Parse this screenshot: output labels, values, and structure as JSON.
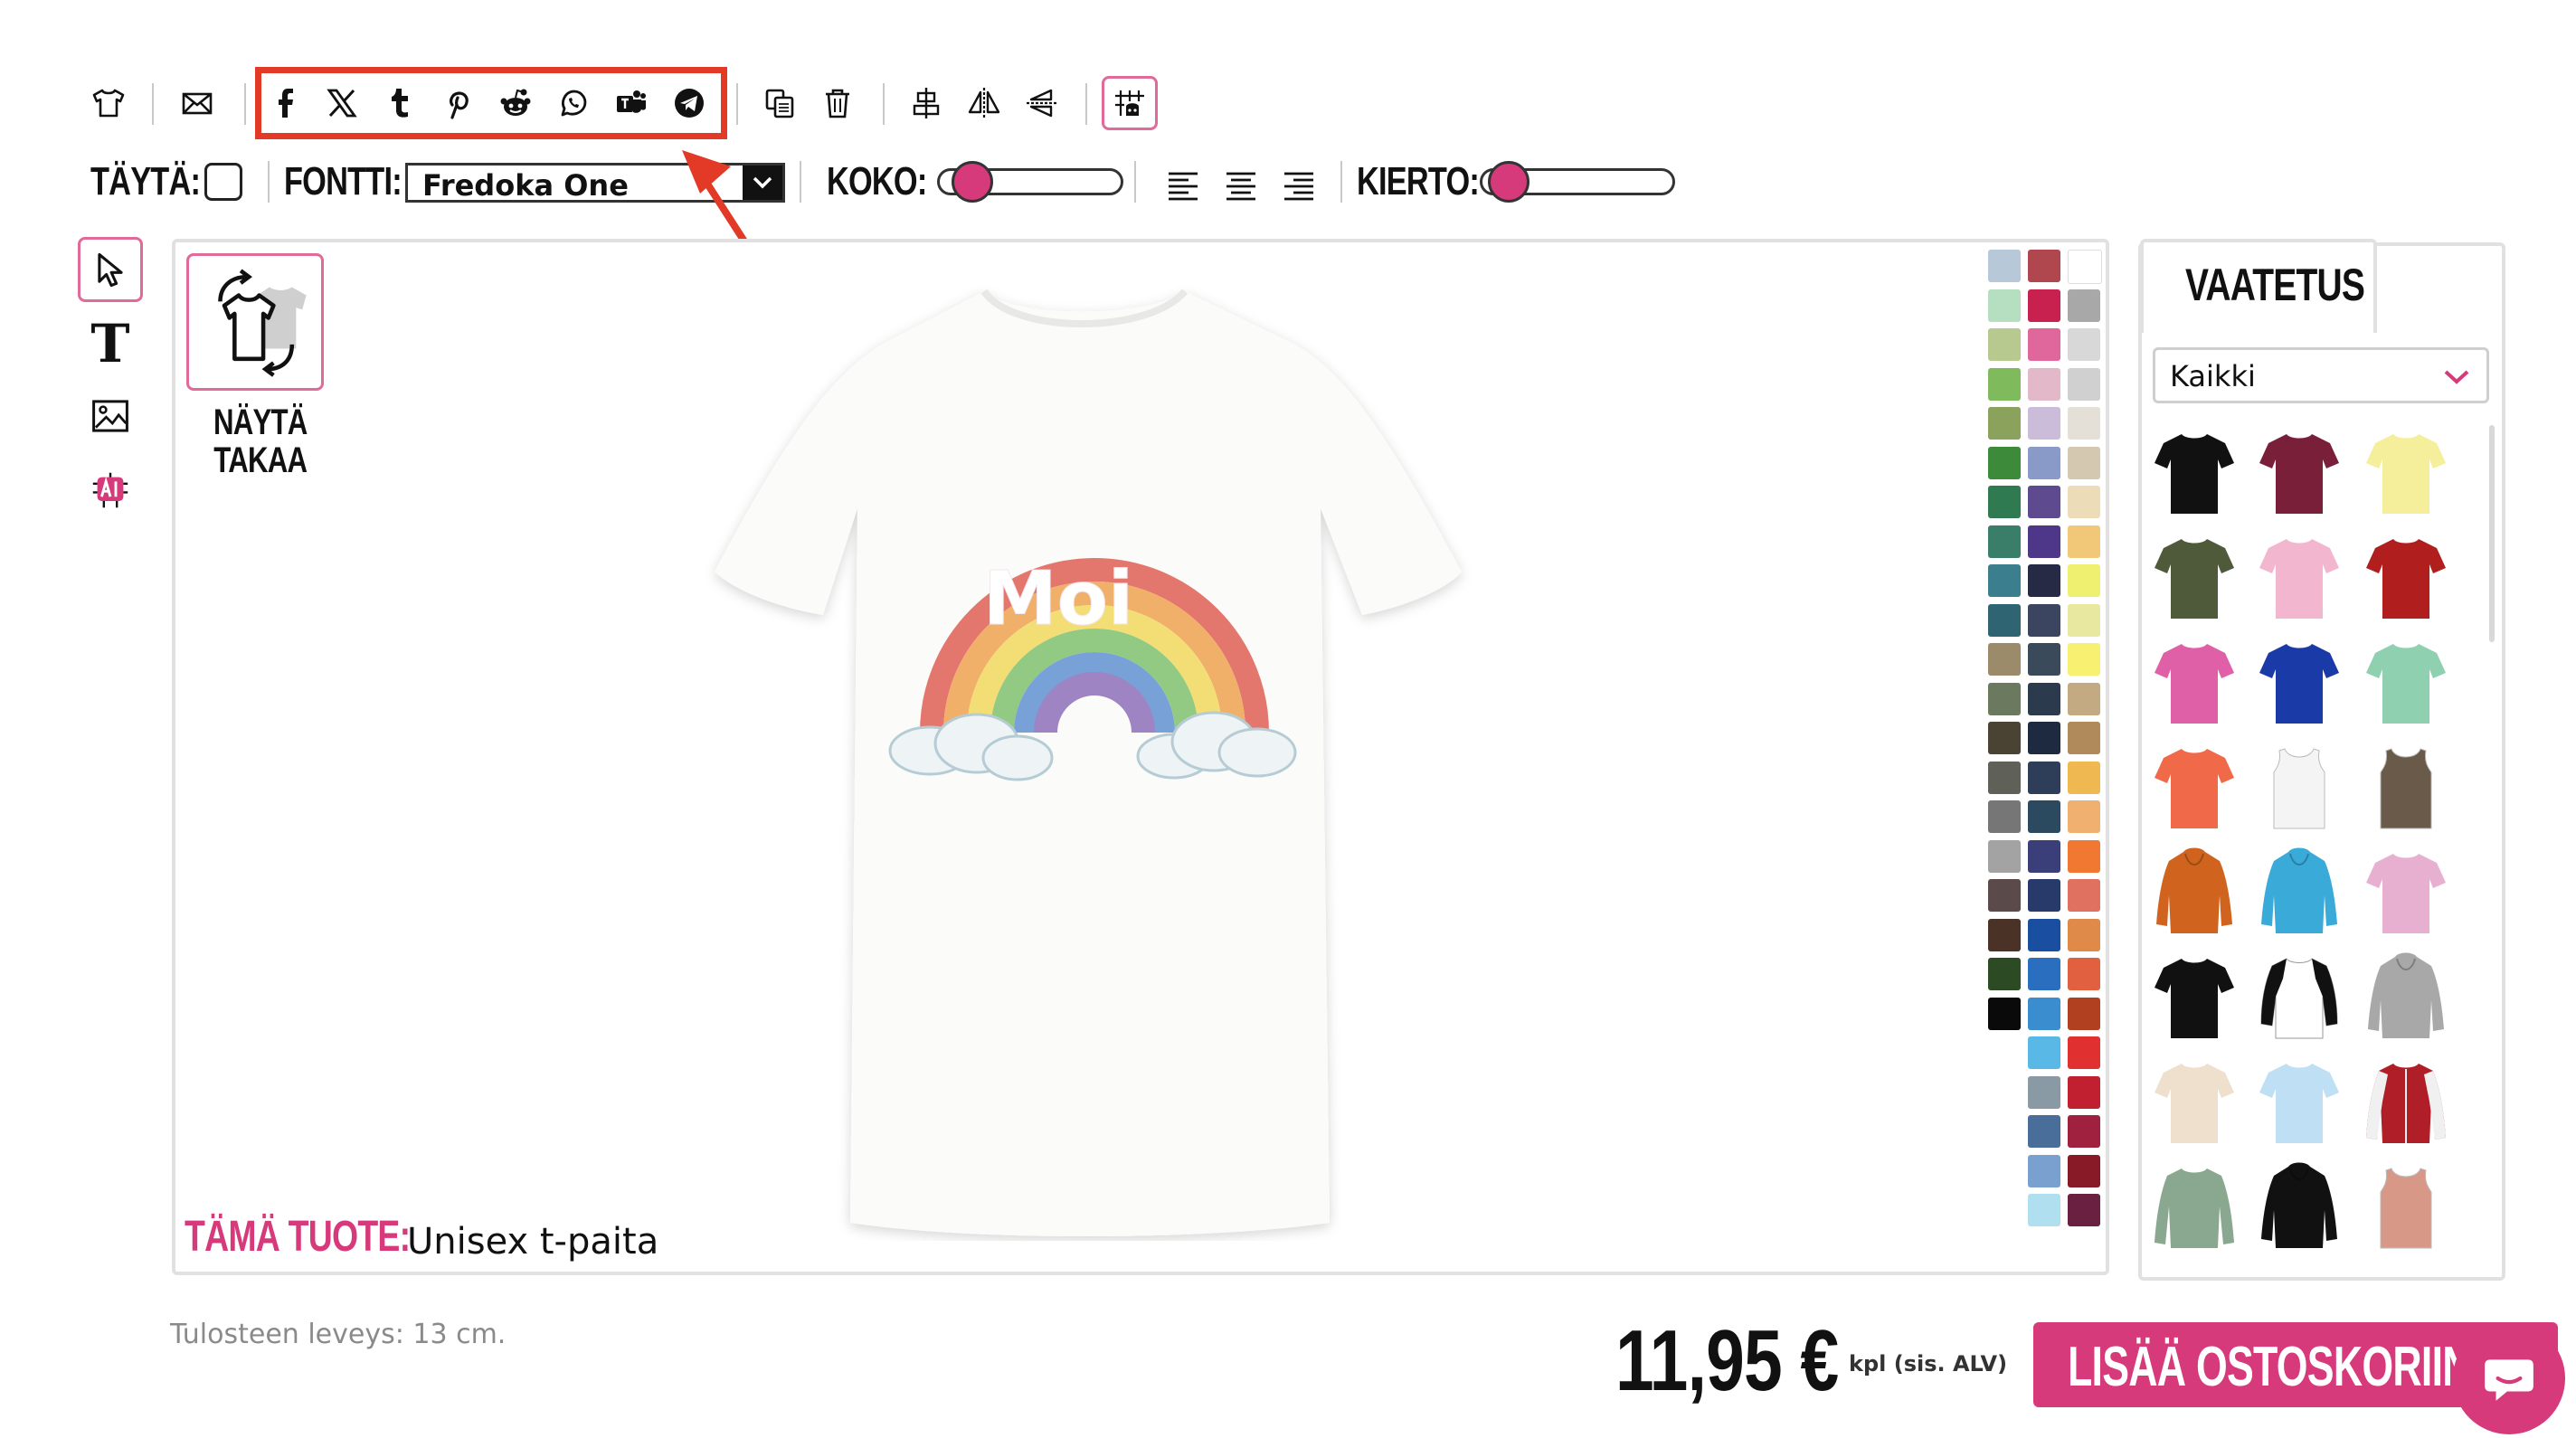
{
  "toolbar": {
    "fill_label": "TÄYTÄ:",
    "font_label": "FONTTI:",
    "font_value": "Fredoka One",
    "size_label": "KOKO:",
    "rotate_label": "KIERTO:",
    "size_level": 0.1,
    "rotate_level": 0.05
  },
  "share_icons": [
    "facebook-icon",
    "x-icon",
    "tumblr-icon",
    "pinterest-icon",
    "reddit-icon",
    "whatsapp-icon",
    "teams-icon",
    "telegram-icon"
  ],
  "canvas": {
    "back_view_label_1": "NÄYTÄ",
    "back_view_label_2": "TAKAA",
    "design_text": "Moi",
    "product_label": "TÄMÄ TUOTE:",
    "product_name": "Unisex t-paita",
    "print_width": "Tulosteen leveys: 13 cm."
  },
  "panel": {
    "tab_label": "VAATETUS",
    "category_value": "Kaikki"
  },
  "footer": {
    "price": "11,95 €",
    "price_note": "kpl (sis. ALV)",
    "cart_label": "LISÄÄ OSTOSKORIIN"
  },
  "colors": {
    "accent": "#d63a7b",
    "highlight": "#e23a26",
    "swatches_col1": [
      "#b7c8d8",
      "#b6dfc2",
      "#b7c98e",
      "#7fba5c",
      "#8aa25b",
      "#3d8a3b",
      "#2f7a50",
      "#3a7e6a",
      "#3b7e8e",
      "#2f6472",
      "#9b8b6b",
      "#6b7a5e",
      "#4a4232",
      "#5f6058",
      "#767676",
      "#a3a3a3",
      "#5a4a4a",
      "#4a3326",
      "#2c4a23",
      "#0a0a0a"
    ],
    "swatches_col2": [
      "#b0474f",
      "#c8204f",
      "#e0679c",
      "#e3b8c8",
      "#cbbcd9",
      "#8a9ac8",
      "#5e4a8e",
      "#4e3688",
      "#272a44",
      "#3b4560",
      "#3b4a5a",
      "#2b3a4c",
      "#1e2a40",
      "#2e3e58",
      "#2b4a60",
      "#3a3f7a",
      "#283a6a",
      "#1a4ea0",
      "#2a6ec0",
      "#3a8ed0",
      "#5ab8e6",
      "#8a9aa4",
      "#4a6e9a",
      "#7aa0d0",
      "#b0e0f0"
    ],
    "swatches_col3": [
      "#ffffff",
      "#a8a8a8",
      "#d8d8d8",
      "#d0d0d0",
      "#e4e0d8",
      "#d4c8b0",
      "#ecdcb8",
      "#f0c878",
      "#f0f070",
      "#e8e8a0",
      "#f8f070",
      "#c4aa82",
      "#b08a5a",
      "#f0b850",
      "#f0b070",
      "#f07830",
      "#e07060",
      "#e08a4a",
      "#e06040",
      "#b04020",
      "#e03030",
      "#c02030",
      "#a02040",
      "#881a28",
      "#6a2040"
    ]
  }
}
